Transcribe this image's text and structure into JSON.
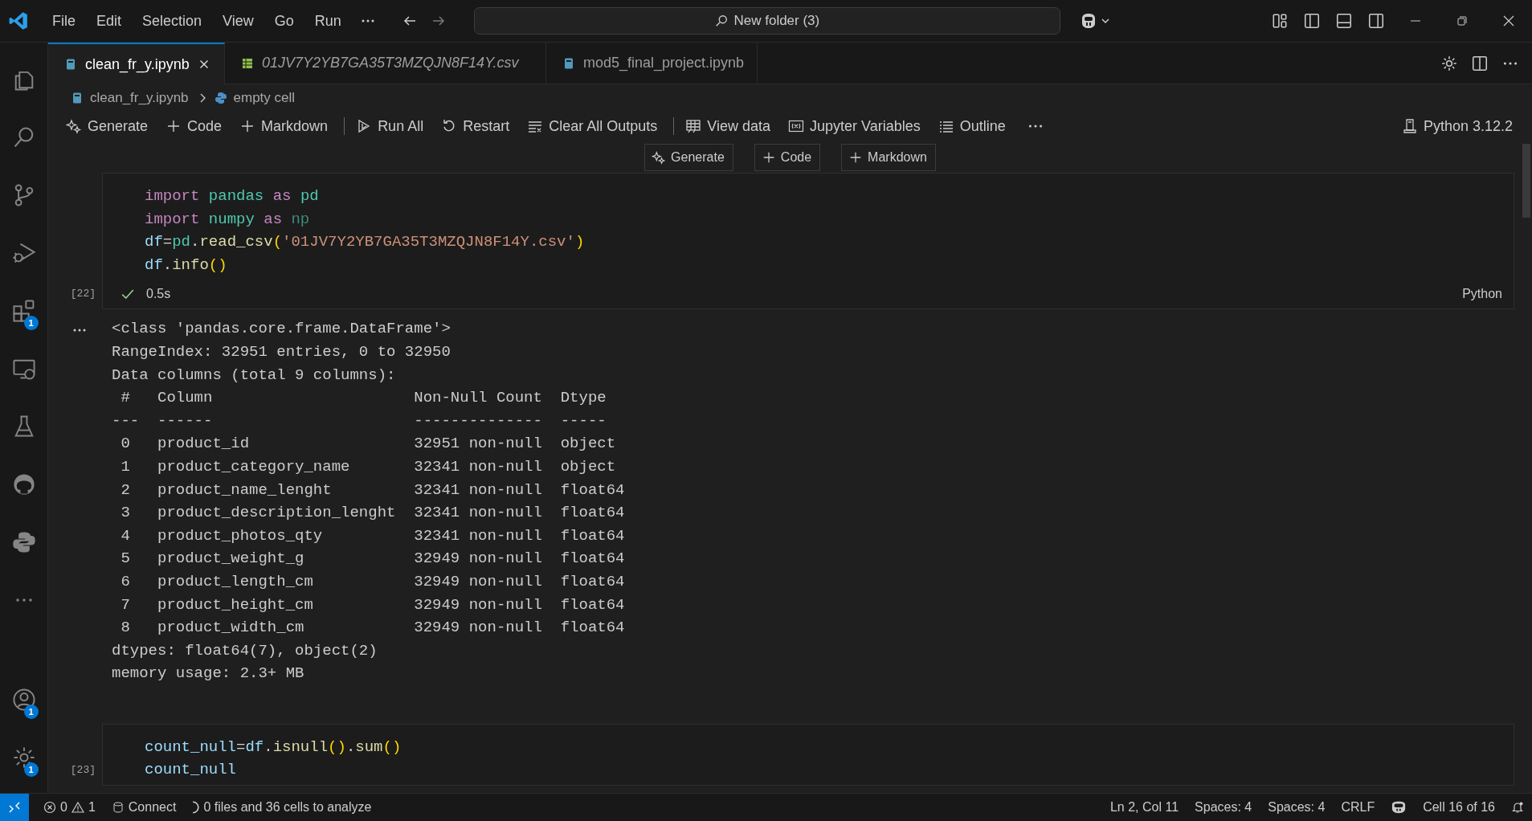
{
  "menu": [
    "File",
    "Edit",
    "Selection",
    "View",
    "Go",
    "Run"
  ],
  "search": {
    "value": "New folder (3)"
  },
  "tabs": [
    {
      "label": "clean_fr_y.ipynb",
      "kind": "notebook",
      "selected": true,
      "preview": false
    },
    {
      "label": "01JV7Y2YB7GA35T3MZQJN8F14Y.csv",
      "kind": "csv",
      "selected": false,
      "preview": true
    },
    {
      "label": "mod5_final_project.ipynb",
      "kind": "notebook",
      "selected": false,
      "preview": false
    }
  ],
  "breadcrumb": [
    {
      "label": "clean_fr_y.ipynb",
      "kind": "notebook"
    },
    {
      "label": "empty cell",
      "kind": "python"
    }
  ],
  "toolbar": [
    [
      {
        "label": "Generate",
        "kind": "sparkle"
      },
      {
        "label": "Code",
        "kind": "plus"
      },
      {
        "label": "Markdown",
        "kind": "plus"
      }
    ],
    [
      {
        "label": "Run All",
        "kind": "run"
      },
      {
        "label": "Restart",
        "kind": "restart"
      },
      {
        "label": "Clear All Outputs",
        "kind": "clear"
      }
    ],
    [
      {
        "label": "View data",
        "kind": "table"
      },
      {
        "label": "Jupyter Variables",
        "kind": "variables"
      },
      {
        "label": "Outline",
        "kind": "list"
      }
    ]
  ],
  "kernel": "Python 3.12.2",
  "cell_toolbar": [
    {
      "label": "Generate",
      "kind": "sparkle"
    },
    {
      "label": "Code",
      "kind": "plus"
    },
    {
      "label": "Markdown",
      "kind": "plus"
    }
  ],
  "activity_bar": [
    {
      "kind": "files"
    },
    {
      "kind": "search"
    },
    {
      "kind": "git"
    },
    {
      "kind": "debug"
    },
    {
      "kind": "extensions",
      "badge": "1"
    },
    {
      "kind": "remote"
    },
    {
      "kind": "flask"
    },
    {
      "kind": "github"
    },
    {
      "kind": "python"
    },
    {
      "kind": "more"
    }
  ],
  "activity_bottom": [
    {
      "kind": "account",
      "badge": "1"
    },
    {
      "kind": "settings",
      "badge": "1"
    }
  ],
  "cells": [
    {
      "count": "[22]",
      "succeeded": true,
      "time": "0.5s",
      "language": "Python",
      "code": [
        [
          {
            "text": "import ",
            "kind": "keyword"
          },
          {
            "text": "pandas ",
            "kind": "module"
          },
          {
            "text": "as ",
            "kind": "keyword"
          },
          {
            "text": "pd",
            "kind": "module"
          }
        ],
        [
          {
            "text": "import ",
            "kind": "keyword"
          },
          {
            "text": "numpy ",
            "kind": "module"
          },
          {
            "text": "as ",
            "kind": "keyword"
          },
          {
            "text": "np",
            "kind": "unused"
          }
        ],
        [
          {
            "text": "df",
            "kind": "variable"
          },
          {
            "text": "="
          },
          {
            "text": "pd",
            "kind": "module"
          },
          {
            "text": "."
          },
          {
            "text": "read_csv",
            "kind": "function"
          },
          {
            "text": "(",
            "kind": "paren"
          },
          {
            "text": "'01JV7Y2YB7GA35T3MZQJN8F14Y.csv'",
            "kind": "string"
          },
          {
            "text": ")",
            "kind": "paren"
          }
        ],
        [
          {
            "text": "df",
            "kind": "variable"
          },
          {
            "text": "."
          },
          {
            "text": "info",
            "kind": "function"
          },
          {
            "text": "()",
            "kind": "paren"
          }
        ]
      ],
      "output": [
        "<class 'pandas.core.frame.DataFrame'>",
        "RangeIndex: 32951 entries, 0 to 32950",
        "Data columns (total 9 columns):",
        " #   Column                      Non-Null Count  Dtype  ",
        "---  ------                      --------------  -----  ",
        " 0   product_id                  32951 non-null  object ",
        " 1   product_category_name       32341 non-null  object ",
        " 2   product_name_lenght         32341 non-null  float64",
        " 3   product_description_lenght  32341 non-null  float64",
        " 4   product_photos_qty          32341 non-null  float64",
        " 5   product_weight_g            32949 non-null  float64",
        " 6   product_length_cm           32949 non-null  float64",
        " 7   product_height_cm           32949 non-null  float64",
        " 8   product_width_cm            32949 non-null  float64",
        "dtypes: float64(7), object(2)",
        "memory usage: 2.3+ MB"
      ]
    },
    {
      "count": "[23]",
      "code": [
        [
          {
            "text": "count_null",
            "kind": "variable"
          },
          {
            "text": "="
          },
          {
            "text": "df",
            "kind": "variable"
          },
          {
            "text": "."
          },
          {
            "text": "isnull",
            "kind": "function"
          },
          {
            "text": "()",
            "kind": "paren"
          },
          {
            "text": "."
          },
          {
            "text": "sum",
            "kind": "function"
          },
          {
            "text": "()",
            "kind": "paren"
          }
        ],
        [
          {
            "text": "count_null",
            "kind": "variable"
          }
        ]
      ]
    }
  ],
  "status_bar": {
    "errors": "0",
    "warnings": "1",
    "connect": "Connect",
    "analysis": "0 files and 36 cells to analyze",
    "position": "Ln 2, Col 11",
    "spaces": [
      "Spaces: 4",
      "Spaces: 4"
    ],
    "eol": "CRLF",
    "cell": "Cell 16 of 16"
  }
}
